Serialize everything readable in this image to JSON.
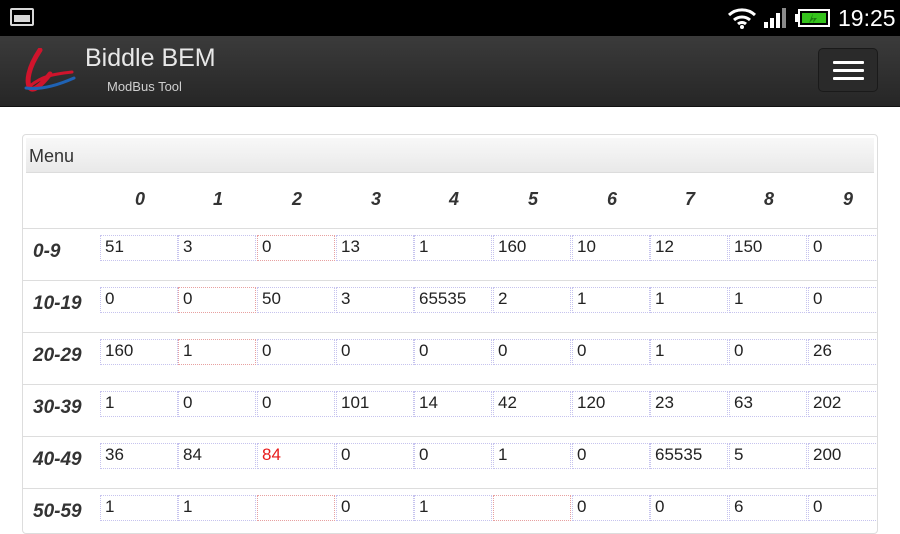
{
  "status_bar": {
    "time": "19:25",
    "icons": [
      "screenshot-icon",
      "wifi-icon",
      "signal-icon",
      "battery-charging-icon"
    ]
  },
  "header": {
    "title": "Biddle BEM",
    "subtitle": "ModBus Tool",
    "menu_icon": "hamburger-menu-icon",
    "colors": {
      "background": "#2f2f2f",
      "logo_red": "#d0142c",
      "logo_blue": "#1f62b4"
    }
  },
  "panel": {
    "heading": "Menu",
    "columns": [
      "0",
      "1",
      "2",
      "3",
      "4",
      "5",
      "6",
      "7",
      "8",
      "9"
    ],
    "rows": [
      {
        "label": "0-9",
        "values": [
          "51",
          "3",
          "0",
          "13",
          "1",
          "160",
          "10",
          "12",
          "150",
          "0"
        ]
      },
      {
        "label": "10-19",
        "values": [
          "0",
          "0",
          "50",
          "3",
          "65535",
          "2",
          "1",
          "1",
          "1",
          "0"
        ]
      },
      {
        "label": "20-29",
        "values": [
          "160",
          "1",
          "0",
          "0",
          "0",
          "0",
          "0",
          "1",
          "0",
          "26"
        ]
      },
      {
        "label": "30-39",
        "values": [
          "1",
          "0",
          "0",
          "101",
          "14",
          "42",
          "120",
          "23",
          "63",
          "202"
        ]
      },
      {
        "label": "40-49",
        "values": [
          "36",
          "84",
          "84",
          "0",
          "0",
          "1",
          "0",
          "65535",
          "5",
          "200"
        ]
      },
      {
        "label": "50-59",
        "values": [
          "1",
          "1",
          "",
          "0",
          "1",
          "",
          "0",
          "0",
          "6",
          "0"
        ]
      }
    ],
    "highlight_color": "#e81a1a"
  }
}
